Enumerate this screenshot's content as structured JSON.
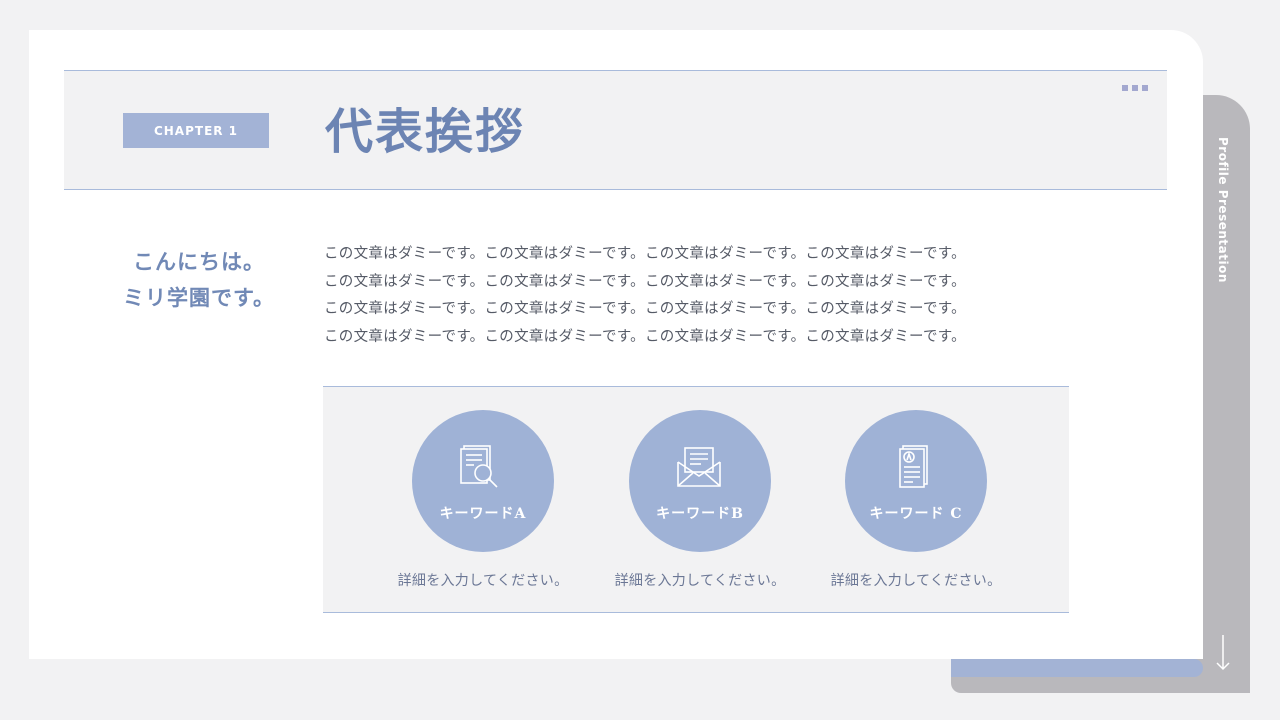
{
  "side_label": "Profile Presentation",
  "chapter": "CHAPTER 1",
  "title": "代表挨拶",
  "greeting": [
    "こんにちは。",
    "ミリ学園です。"
  ],
  "body_lines": [
    "この文章はダミーです。この文章はダミーです。この文章はダミーです。この文章はダミーです。",
    "この文章はダミーです。この文章はダミーです。この文章はダミーです。この文章はダミーです。",
    "この文章はダミーです。この文章はダミーです。この文章はダミーです。この文章はダミーです。",
    "この文章はダミーです。この文章はダミーです。この文章はダミーです。この文章はダミーです。"
  ],
  "keywords": [
    {
      "label": "キーワードA",
      "desc": "詳細を入力してください。",
      "icon": "document-search-icon"
    },
    {
      "label": "キーワードB",
      "desc": "詳細を入力してください。",
      "icon": "envelope-letter-icon"
    },
    {
      "label": "キーワード C",
      "desc": "詳細を入力してください。",
      "icon": "documents-badge-icon"
    }
  ],
  "colors": {
    "accent": "#9fb2d6",
    "title": "#6c84b3",
    "binder": "#b9b8bc",
    "background": "#f2f2f3"
  }
}
